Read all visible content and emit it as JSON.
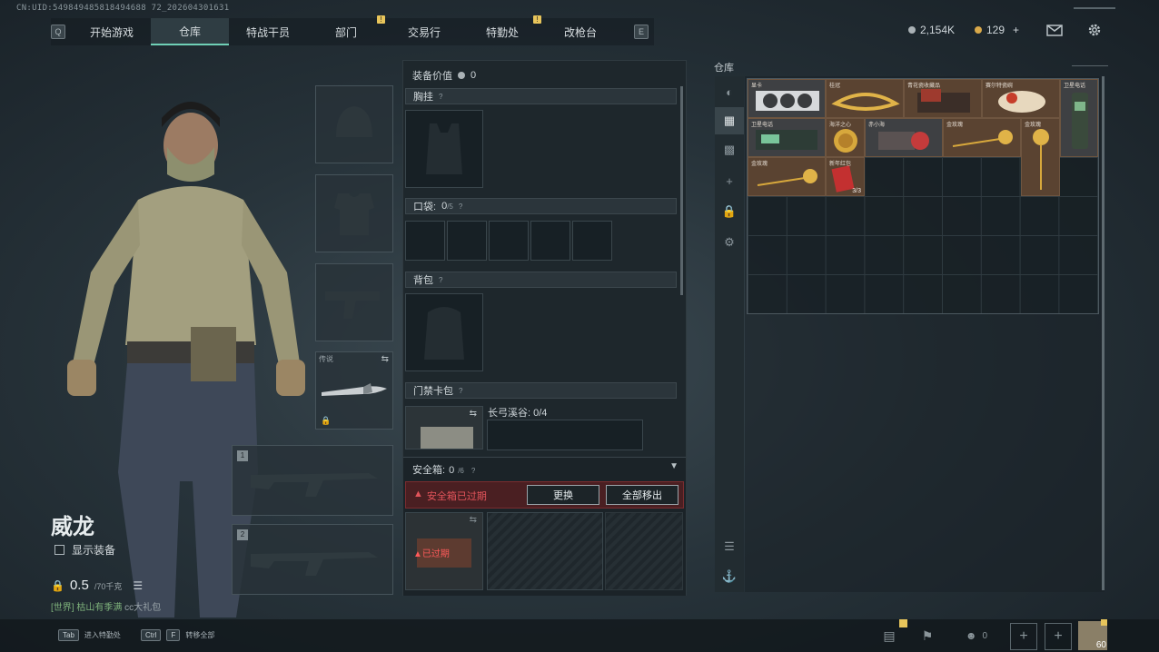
{
  "uid": "CN:UID:549849485818494688 72_202604301631",
  "tabs": {
    "left_key": "Q",
    "right_key": "E",
    "items": [
      {
        "label": "开始游戏",
        "badge": ""
      },
      {
        "label": "仓库",
        "badge": "",
        "active": true
      },
      {
        "label": "特战干员",
        "badge": ""
      },
      {
        "label": "部门",
        "badge": "!"
      },
      {
        "label": "交易行",
        "badge": ""
      },
      {
        "label": "特勤处",
        "badge": "!"
      },
      {
        "label": "改枪台",
        "badge": ""
      }
    ]
  },
  "currency": {
    "silver": "2,154K",
    "gold": "129",
    "gold_add": "+"
  },
  "character": {
    "name": "威龙",
    "show_equipment_label": "显示装备",
    "weight_value": "0.5",
    "weight_max": "/70千克",
    "world_channel": "[世界] 枯山有季满",
    "world_message": "cc大礼包"
  },
  "slots": {
    "melee_label": "传说",
    "weapon1_num": "1",
    "weapon2_num": "2"
  },
  "equipment": {
    "value_label": "装备价值",
    "value": "0",
    "chest_rig_label": "胸挂",
    "pockets_label": "口袋:",
    "pockets_count": "0",
    "pockets_max": "/5",
    "backpack_label": "背包",
    "keycard_label": "门禁卡包",
    "keycard_area": "长弓溪谷: 0/4",
    "safe_box_label": "安全箱:",
    "safe_box_count": "0",
    "safe_box_max": "/6",
    "expired_warning": "安全箱已过期",
    "replace_button": "更换",
    "remove_all_button": "全部移出",
    "expired_tag": "已过期"
  },
  "warehouse": {
    "title": "仓库",
    "items": [
      {
        "name": "显卡",
        "kind": "gpu"
      },
      {
        "name": "桂冠",
        "kind": "crown"
      },
      {
        "name": "青花瓷收藏品",
        "kind": "box"
      },
      {
        "name": "赛尔特瓷碗",
        "kind": "figure"
      },
      {
        "name": "卫星电话",
        "kind": "phone"
      },
      {
        "name": "卫星电话",
        "kind": "battery"
      },
      {
        "name": "海洋之心",
        "kind": "coin"
      },
      {
        "name": "赤小海",
        "kind": "device"
      },
      {
        "name": "金玫瑰",
        "kind": "rose"
      },
      {
        "name": "金玫瑰",
        "kind": "rose-v"
      },
      {
        "name": "金玫瑰",
        "kind": "rose"
      },
      {
        "name": "新年红包",
        "kind": "envelope",
        "count": "3/3"
      }
    ]
  },
  "bottom": {
    "tab_key": "Tab",
    "tab_label": "进入特勤处",
    "ctrl_key": "Ctrl",
    "f_key": "F",
    "ctrl_label": "转移全部",
    "friends_count": "0",
    "avatar_level": "60"
  }
}
